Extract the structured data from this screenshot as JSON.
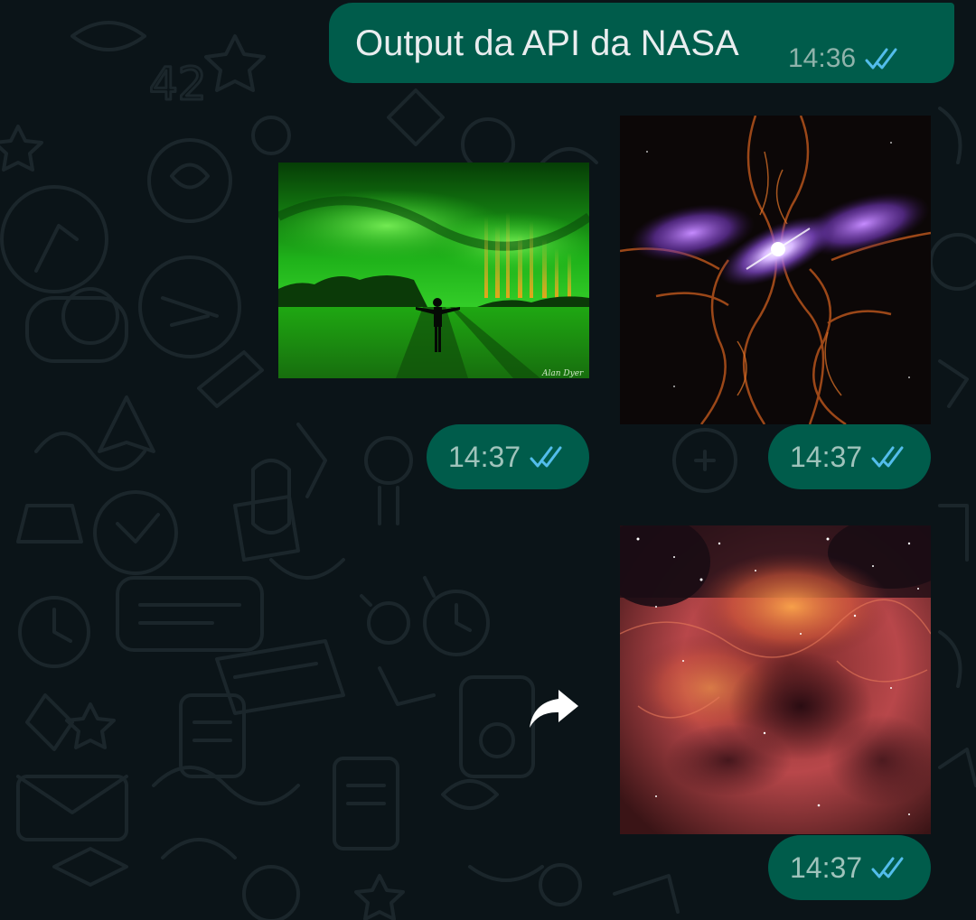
{
  "chat": {
    "messages": [
      {
        "text": "Output da API da NASA",
        "time": "14:36",
        "status": "read"
      },
      {
        "type": "image",
        "description": "aurora",
        "time": "14:37",
        "status": "read"
      },
      {
        "type": "image",
        "description": "nebula-purple",
        "time": "14:37",
        "status": "read"
      },
      {
        "type": "image",
        "description": "nebula-red",
        "time": "14:37",
        "status": "read"
      }
    ],
    "photo_signature": "Alan Dyer"
  },
  "colors": {
    "background": "#0b1418",
    "bubble": "#005c4b",
    "bubble_text": "#e9edef",
    "meta_text": "#9fc3bb",
    "read_ticks": "#53bdeb"
  },
  "icons": {
    "read_status": "double-check-icon",
    "forward": "forward-icon"
  }
}
